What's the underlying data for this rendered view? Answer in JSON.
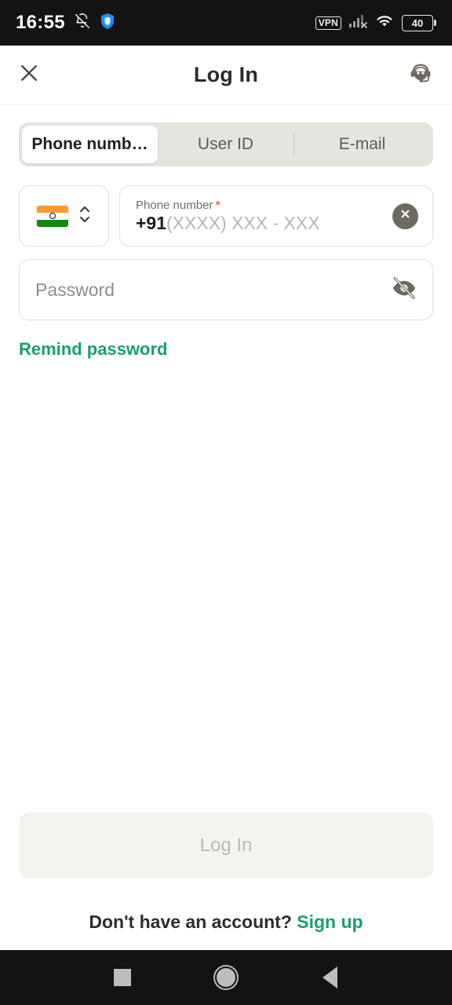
{
  "status_bar": {
    "time": "16:55",
    "dnd_icon": "bell-slash-icon",
    "shield_icon": "shield-icon",
    "vpn_label": "VPN",
    "signal_icon": "signal-no-service-icon",
    "wifi_icon": "wifi-icon",
    "battery_level": "40"
  },
  "header": {
    "close_icon": "close-icon",
    "title": "Log In",
    "support_icon": "headset-support-icon"
  },
  "tabs": {
    "items": [
      {
        "label": "Phone numb…",
        "active": true
      },
      {
        "label": "User ID",
        "active": false
      },
      {
        "label": "E-mail",
        "active": false
      }
    ]
  },
  "phone_field": {
    "country_flag": "india-flag-icon",
    "stepper_icon": "chevron-up-down-icon",
    "label": "Phone number",
    "required_marker": "*",
    "prefix": "+91",
    "placeholder": "(XXXX) XXX - XXX",
    "clear_icon": "clear-circle-icon"
  },
  "password_field": {
    "placeholder": "Password",
    "visibility_icon": "eye-off-icon"
  },
  "links": {
    "remind_password": "Remind password"
  },
  "footer": {
    "login_button": "Log In",
    "signup_prompt": "Don't have an account?",
    "signup_link": "Sign up"
  },
  "nav_bar": {
    "recents_icon": "square-recents-icon",
    "home_icon": "circle-home-icon",
    "back_icon": "triangle-back-icon"
  },
  "colors": {
    "accent_green": "#17a06a",
    "required_red": "#e8462f",
    "tab_track": "#e6e4df",
    "disabled_button": "#f5f3ef",
    "system_bar": "#131313"
  }
}
